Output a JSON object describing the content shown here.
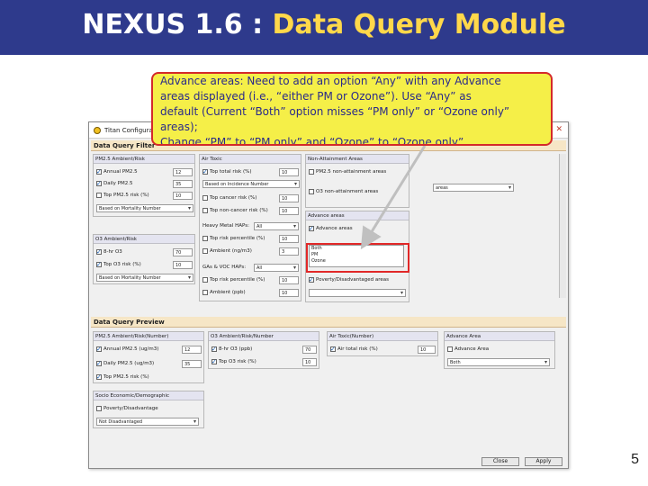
{
  "slide": {
    "title_prefix": "NEXUS 1.6 : ",
    "title_accent": "Data Query Module",
    "page_number": "5"
  },
  "callout": {
    "line1": "Advance areas: Need to add an option “Any” with any Advance",
    "line2": "areas displayed (i.e., “either PM or Ozone”). Use “Any” as",
    "line3": "default (Current “Both” option misses “PM only” or “Ozone only”",
    "line4": "areas);",
    "line5": "Change “PM” to “PM only” and “Ozone” to “Ozone only”"
  },
  "window": {
    "title": "Titan Configuration",
    "close_glyph": "✕",
    "filter_section": "Data Query Filter",
    "preview_section": "Data Query Preview",
    "pm25": {
      "header": "PM2.5 Ambient/Risk",
      "annual": {
        "label": "Annual PM2.5",
        "value": "12",
        "checked": true
      },
      "daily": {
        "label": "Daily PM2.5",
        "value": "35",
        "checked": true
      },
      "top_risk": {
        "label": "Top PM2.5 risk (%)",
        "value": "10",
        "checked": false
      },
      "select": "Based on Mortality Number"
    },
    "o3": {
      "header": "O3 Ambient/Risk",
      "ambient": {
        "label": "8-hr O3",
        "value": "70",
        "checked": true
      },
      "top_risk": {
        "label": "Top O3 risk (%)",
        "value": "10",
        "checked": true
      },
      "select": "Based on Mortality Number"
    },
    "air_toxic": {
      "header": "Air Toxic",
      "total_risk": {
        "label": "Top total risk (%)",
        "value": "10",
        "checked": true
      },
      "total_select": "Based on Incidence Number",
      "cancer": {
        "label": "Top cancer risk (%)",
        "value": "10",
        "checked": false
      },
      "noncancer": {
        "label": "Top non-cancer risk (%)",
        "value": "10",
        "checked": false
      },
      "heavy_label": "Heavy Metal HAPs:",
      "heavy_value": "All",
      "heavy_pct": {
        "label": "Top risk percentile (%)",
        "value": "10",
        "checked": false
      },
      "heavy_amb": {
        "label": "Ambient (ng/m3)",
        "value": "3",
        "checked": false
      },
      "voc_label": "GAs & VOC HAPs:",
      "voc_value": "All",
      "voc_pct": {
        "label": "Top risk percentile (%)",
        "value": "10",
        "checked": false
      },
      "voc_amb": {
        "label": "Ambient (ppb)",
        "value": "10",
        "checked": false
      }
    },
    "nonattain": {
      "header": "Non-Attainment Areas",
      "pm25": {
        "label": "PM2.5 non-attainment areas",
        "checked": false
      },
      "o3": {
        "label": "O3 non-attainment areas",
        "checked": false
      },
      "right_select": "areas"
    },
    "advance": {
      "header": "Advance areas",
      "check": {
        "label": "Advance areas",
        "checked": true
      },
      "options": [
        "Both",
        "PM",
        "Ozone"
      ],
      "poverty": {
        "label": "Poverty/Disadvantaged areas",
        "checked": true
      }
    },
    "preview": {
      "pm_header": "PM2.5 Ambient/Risk(Number)",
      "pm_annual": {
        "label": "Annual PM2.5 (ug/m3)",
        "value": "12",
        "checked": true
      },
      "pm_daily": {
        "label": "Daily PM2.5 (ug/m3)",
        "value": "35",
        "checked": true
      },
      "pm_top": {
        "label": "Top PM2.5 risk (%)",
        "value": "",
        "checked": true
      },
      "o3_header": "O3 Ambient/Risk/Number",
      "o3_amb": {
        "label": "8-hr O3 (ppb)",
        "value": "70",
        "checked": true
      },
      "o3_risk": {
        "label": "Top O3 risk (%)",
        "value": "10",
        "checked": true
      },
      "at_header": "Air Toxic(Number)",
      "at_total": {
        "label": "Air total risk (%)",
        "value": "10",
        "checked": true
      },
      "adv_header": "Advance Area",
      "adv_check": {
        "label": "Advance Area",
        "checked": false
      },
      "adv_select": "Both",
      "socio_header": "Socio Economic/Demographic",
      "socio_check": {
        "label": "Poverty/Disadvantage",
        "checked": false
      },
      "socio_select": "Not Disadvantaged"
    },
    "buttons": {
      "close": "Close",
      "apply": "Apply"
    }
  },
  "colors": {
    "title_bar": "#2e3a8c",
    "title_accent": "#ffd84a",
    "callout_bg": "#f5ef48",
    "callout_border": "#d42a2a",
    "highlight": "#e12828"
  }
}
